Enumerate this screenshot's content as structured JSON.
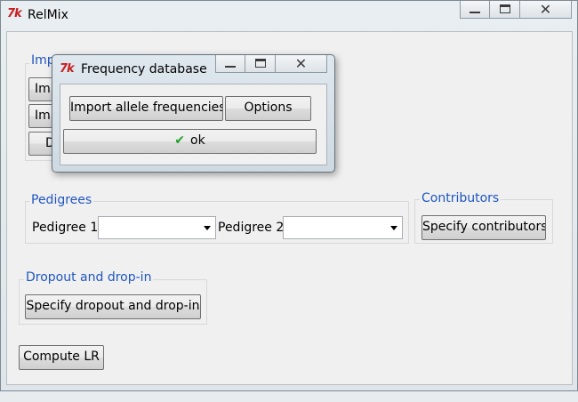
{
  "main_window": {
    "title": "RelMix",
    "icon": "tk-feather-icon",
    "controls": [
      "minimize-icon",
      "maximize-icon",
      "close-icon"
    ]
  },
  "import_section": {
    "title_visible": "Imp",
    "buttons": [
      "Imp",
      "Imp",
      "D"
    ]
  },
  "pedigrees": {
    "title": "Pedigrees",
    "pedigree1_label": "Pedigree 1",
    "pedigree1_value": "",
    "pedigree2_label": "Pedigree 2",
    "pedigree2_value": ""
  },
  "contributors": {
    "title": "Contributors",
    "button": "Specify contributors"
  },
  "dropout": {
    "title": "Dropout and drop-in",
    "button": "Specify dropout and drop-in"
  },
  "compute_button": "Compute LR",
  "dialog": {
    "title": "Frequency database",
    "icon": "tk-feather-icon",
    "import_button": "Import allele frequencies",
    "options_button": "Options",
    "ok_button": "ok",
    "ok_icon": "checkmark-icon"
  },
  "colors": {
    "group_title": "#1f56c0",
    "tk_icon": "#c81e1e",
    "checkmark": "#22a12a"
  }
}
